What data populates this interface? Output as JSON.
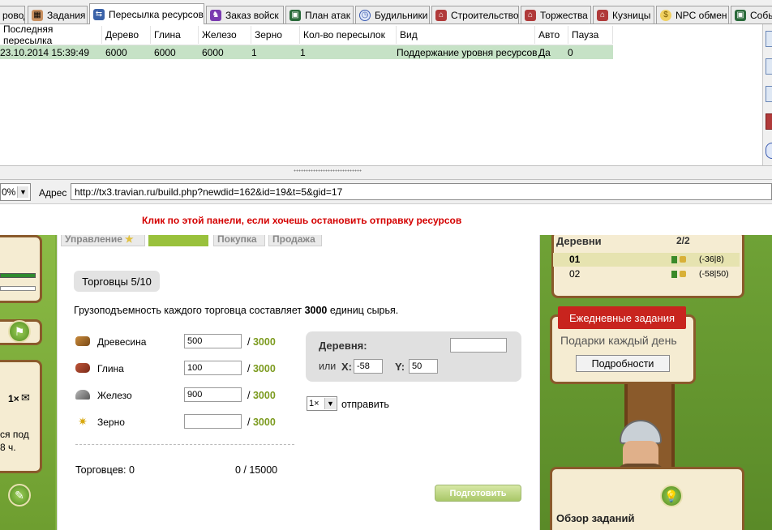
{
  "tabs": [
    {
      "label": "ровод",
      "icon": "arrows-icon",
      "color": "#9c6b3a"
    },
    {
      "label": "Задания",
      "icon": "tasks-icon",
      "color": "#8a4b2a"
    },
    {
      "label": "Пересылка ресурсов",
      "icon": "transfer-icon",
      "color": "#3a62a8",
      "active": true
    },
    {
      "label": "Заказ войск",
      "icon": "troops-icon",
      "color": "#7a3ab0"
    },
    {
      "label": "План атак",
      "icon": "attack-plan-icon",
      "color": "#2a6a3a"
    },
    {
      "label": "Будильники",
      "icon": "alarm-icon",
      "color": "#3a5ab0"
    },
    {
      "label": "Строительство",
      "icon": "building-icon",
      "color": "#b03a3a"
    },
    {
      "label": "Торжества",
      "icon": "celebration-icon",
      "color": "#b03a3a"
    },
    {
      "label": "Кузницы",
      "icon": "smithy-icon",
      "color": "#b03a3a"
    },
    {
      "label": "NPC обмен",
      "icon": "npc-coins-icon",
      "color": "#d0a020"
    },
    {
      "label": "Собы",
      "icon": "events-icon",
      "color": "#2a6a3a"
    }
  ],
  "grid": {
    "columns": [
      "Последняя пересылка",
      "Дерево",
      "Глина",
      "Железо",
      "Зерно",
      "Кол-во пересылок",
      "Вид",
      "Авто",
      "Пауза"
    ],
    "rows": [
      [
        "23.10.2014 15:39:49",
        "6000",
        "6000",
        "6000",
        "1",
        "1",
        "Поддержание уровня ресурсов",
        "Да",
        "0"
      ]
    ]
  },
  "address": {
    "zoom": "0%",
    "label": "Адрес",
    "url": "http://tx3.travian.ru/build.php?newdid=162&id=19&t=5&gid=17"
  },
  "warning": "Клик по этой панели, если хочешь остановить  отправку ресурсов",
  "market": {
    "subtabs": [
      "Управление",
      "",
      "Покупка",
      "Продажа"
    ],
    "merchants": "Торговцы 5/10",
    "capacity_prefix": "Грузоподъемность каждого торговца составляет ",
    "capacity_value": "3000",
    "capacity_suffix": " единиц сырья.",
    "resources": [
      {
        "name": "Древесина",
        "value": "500",
        "max": "3000",
        "icon": "wood-icon"
      },
      {
        "name": "Глина",
        "value": "100",
        "max": "3000",
        "icon": "clay-icon"
      },
      {
        "name": "Железо",
        "value": "900",
        "max": "3000",
        "icon": "iron-icon"
      },
      {
        "name": "Зерно",
        "value": "",
        "max": "3000",
        "icon": "crop-icon"
      }
    ],
    "max_separator": "/",
    "traders": "Торговцев: 0",
    "load": "0  / 15000",
    "village_label": "Деревня:",
    "village_value": "",
    "or_label": "или",
    "x_label": "X:",
    "x_value": "-58",
    "y_label": "Y:",
    "y_value": "50",
    "times": "1×",
    "send_label": "отправить",
    "prepare_button": "Подготовить"
  },
  "sidebar_left": {
    "badge": "1×",
    "text_line1": "ся под",
    "text_line2": "8 ч."
  },
  "sidebar_right": {
    "villages_title": "Деревни",
    "villages_count": "2/2",
    "villages": [
      {
        "name": "01",
        "coords": "(-36|8)"
      },
      {
        "name": "02",
        "coords": "(-58|50)"
      }
    ],
    "daily_tasks": "Ежедневные задания",
    "gifts": "Подарки каждый день",
    "details_button": "Подробности",
    "quests_overview": "Обзор заданий"
  }
}
